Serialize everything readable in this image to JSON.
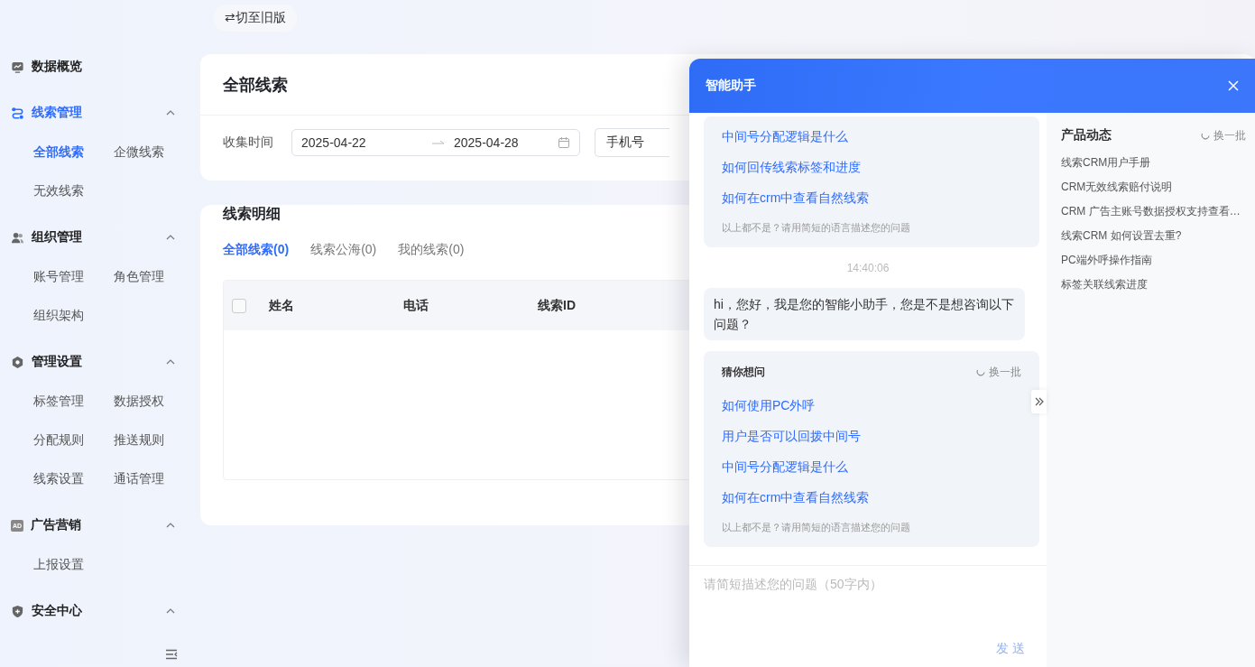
{
  "topbar": {
    "switch_button": "⇄切至旧版"
  },
  "sidebar": {
    "groups": [
      {
        "title": "数据概览",
        "selected": false
      },
      {
        "title": "线索管理",
        "selected": true,
        "expanded": true,
        "items": [
          {
            "label": "全部线索",
            "selected": true
          },
          {
            "label": "企微线索",
            "selected": false
          },
          {
            "label": "无效线索",
            "selected": false
          }
        ]
      },
      {
        "title": "组织管理",
        "selected": false,
        "expanded": true,
        "items": [
          {
            "label": "账号管理",
            "selected": false
          },
          {
            "label": "角色管理",
            "selected": false
          },
          {
            "label": "组织架构",
            "selected": false
          }
        ]
      },
      {
        "title": "管理设置",
        "selected": false,
        "expanded": true,
        "items": [
          {
            "label": "标签管理",
            "selected": false
          },
          {
            "label": "数据授权",
            "selected": false
          },
          {
            "label": "分配规则",
            "selected": false
          },
          {
            "label": "推送规则",
            "selected": false
          },
          {
            "label": "线索设置",
            "selected": false
          },
          {
            "label": "通话管理",
            "selected": false
          }
        ]
      },
      {
        "title": "广告营销",
        "selected": false,
        "expanded": true,
        "badge": "AD",
        "items": [
          {
            "label": "上报设置",
            "selected": false
          }
        ]
      },
      {
        "title": "安全中心",
        "selected": false,
        "expanded": true
      }
    ]
  },
  "page_title": "全部线索",
  "filter": {
    "label": "收集时间",
    "start": "2025-04-22",
    "end": "2025-04-28",
    "select": "手机号"
  },
  "detail": {
    "title": "线索明细",
    "tabs": [
      {
        "label": "全部线索(0)",
        "selected": true
      },
      {
        "label": "线索公海(0)",
        "selected": false
      },
      {
        "label": "我的线索(0)",
        "selected": false
      }
    ],
    "select_all_checked": false,
    "columns": [
      "姓名",
      "电话",
      "线索ID"
    ]
  },
  "assistant": {
    "title": "智能助手",
    "messages": [
      {
        "kind": "suggestions",
        "links": [
          "中间号分配逻辑是什么",
          "如何回传线索标签和进度",
          "如何在crm中查看自然线索"
        ],
        "hint": "以上都不是？请用简短的语言描述您的问题"
      },
      {
        "kind": "time",
        "text": "14:40:06"
      },
      {
        "kind": "bot",
        "text": "hi，您好，我是您的智能小助手，您是不是想咨询以下问题？"
      },
      {
        "kind": "suggestions",
        "title": "猜你想问",
        "refresh": "换一批",
        "links": [
          "如何使用PC外呼",
          "用户是否可以回拨中间号",
          "中间号分配逻辑是什么",
          "如何在crm中查看自然线索"
        ],
        "hint": "以上都不是？请用简短的语言描述您的问题"
      }
    ],
    "input": {
      "placeholder": "请简短描述您的问题（50字内）"
    },
    "send_button": {
      "label": "发 送",
      "disabled": true
    },
    "news": {
      "title": "产品动态",
      "refresh": "换一批",
      "items": [
        "线索CRM用户手册",
        "CRM无效线索赔付说明",
        "CRM 广告主账号数据授权支持查看…",
        "线索CRM 如何设置去重?",
        "PC端外呼操作指南",
        "标签关联线索进度"
      ]
    }
  }
}
